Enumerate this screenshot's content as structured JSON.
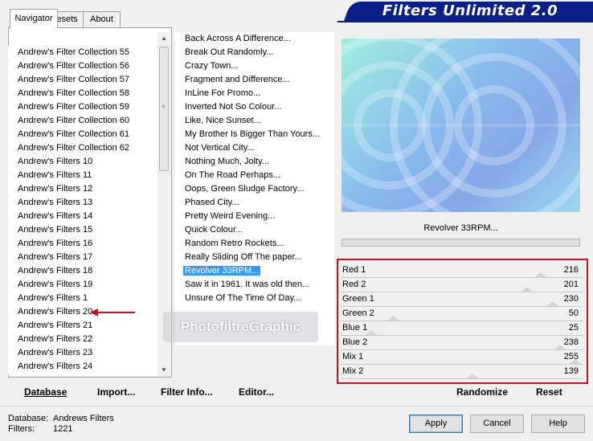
{
  "tabs": [
    "Navigator",
    "Presets",
    "About"
  ],
  "banner_title": "Filters Unlimited 2.0",
  "categories": [
    "Andrew's Filter Collection 55",
    "Andrew's Filter Collection 56",
    "Andrew's Filter Collection 57",
    "Andrew's Filter Collection 58",
    "Andrew's Filter Collection 59",
    "Andrew's Filter Collection 60",
    "Andrew's Filter Collection 61",
    "Andrew's Filter Collection 62",
    "Andrew's Filters 10",
    "Andrew's Filters 11",
    "Andrew's Filters 12",
    "Andrew's Filters 13",
    "Andrew's Filters 14",
    "Andrew's Filters 15",
    "Andrew's Filters 16",
    "Andrew's Filters 17",
    "Andrew's Filters 18",
    "Andrew's Filters 19",
    "Andrew's Filters 1",
    "Andrew's Filters 20",
    "Andrew's Filters 21",
    "Andrew's Filters 22",
    "Andrew's Filters 23",
    "Andrew's Filters 24"
  ],
  "filters": [
    "Back Across A Difference...",
    "Break Out Randomly...",
    "Crazy Town...",
    "Fragment and Difference...",
    "InLine For Promo...",
    "Inverted Not So Colour...",
    "Like, Nice Sunset...",
    "My Brother Is Bigger Than Yours...",
    "Not Vertical City...",
    "Nothing Much, Jolty...",
    "On The Road Perhaps...",
    "Oops, Green Sludge Factory...",
    "Phased City...",
    "Pretty Weird Evening...",
    "Quick Colour...",
    "Random Retro Rockets...",
    "Really Sliding Off The paper...",
    "Revolver 33RPM...",
    "Saw it in 1961. It was old then...",
    "Unsure Of The Time Of Day..."
  ],
  "selected_filter_index": 17,
  "preview": {
    "filter_name": "Revolver 33RPM..."
  },
  "sliders": [
    {
      "label": "Red 1",
      "value": 216
    },
    {
      "label": "Red 2",
      "value": 201
    },
    {
      "label": "Green 1",
      "value": 230
    },
    {
      "label": "Green 2",
      "value": 50
    },
    {
      "label": "Blue 1",
      "value": 25
    },
    {
      "label": "Blue 2",
      "value": 238
    },
    {
      "label": "Mix 1",
      "value": 255
    },
    {
      "label": "Mix 2",
      "value": 139
    }
  ],
  "slider_max": 255,
  "links": {
    "database": "Database",
    "import": "Import...",
    "filter_info": "Filter Info...",
    "editor": "Editor...",
    "randomize": "Randomize",
    "reset": "Reset"
  },
  "status": {
    "database_label": "Database:",
    "database_value": "Andrews Filters",
    "filters_label": "Filters:",
    "filters_value": "1221"
  },
  "buttons": {
    "apply": "Apply",
    "cancel": "Cancel",
    "help": "Help"
  },
  "watermark": "PhotofiltreGraphic",
  "colors": {
    "accent_red": "#d01020",
    "banner_blue": "#0a1f8a",
    "selection": "#3399ff"
  }
}
